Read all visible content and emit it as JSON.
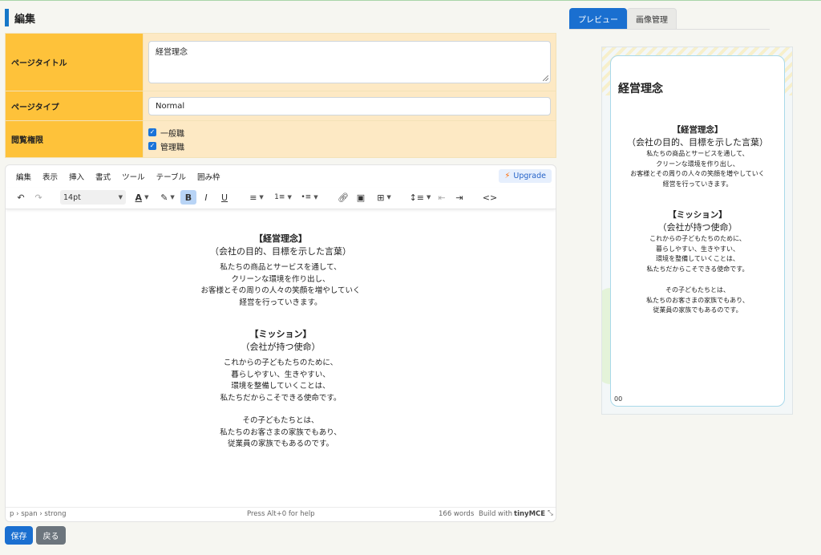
{
  "section_title": "編集",
  "form": {
    "page_title_label": "ページタイトル",
    "page_title_value": "経営理念",
    "page_type_label": "ページタイプ",
    "page_type_value": "Normal",
    "access_label": "閲覧権限",
    "access_options": [
      {
        "label": "一般職",
        "checked": true
      },
      {
        "label": "管理職",
        "checked": true
      }
    ]
  },
  "editor": {
    "menu": [
      "編集",
      "表示",
      "挿入",
      "書式",
      "ツール",
      "テーブル",
      "囲み枠"
    ],
    "upgrade_label": "Upgrade",
    "font_size": "14pt",
    "content": {
      "h1": "【経営理念】",
      "sub1": "（会社の目的、目標を示した言葉）",
      "body1": [
        "私たちの商品とサービスを通して、",
        "クリーンな環境を作り出し、",
        "お客様とその周りの人々の笑顔を増やしていく",
        "経営を行っていきます。"
      ],
      "h2": "【ミッション】",
      "sub2": "（会社が持つ使命）",
      "body2": [
        "これからの子どもたちのために、",
        "暮らしやすい、生きやすい、",
        "環境を整備していくことは、",
        "私たちだからこそできる使命です。"
      ],
      "body3": [
        "その子どもたちとは、",
        "私たちのお客さまの家族でもあり、",
        "従業員の家族でもあるのです。"
      ]
    },
    "status": {
      "path": "p › span › strong",
      "help": "Press Alt+0 for help",
      "words": "166 words",
      "build_with": "Build with",
      "brand": "tinyMCE"
    }
  },
  "buttons": {
    "save": "保存",
    "back": "戻る"
  },
  "tabs": {
    "preview": "プレビュー",
    "images": "画像管理"
  },
  "preview": {
    "title": "経営理念",
    "page_number": "00"
  },
  "colors": {
    "accent": "#1a6fd0",
    "label_bg": "#fec23a",
    "value_bg": "#fde9c4"
  }
}
